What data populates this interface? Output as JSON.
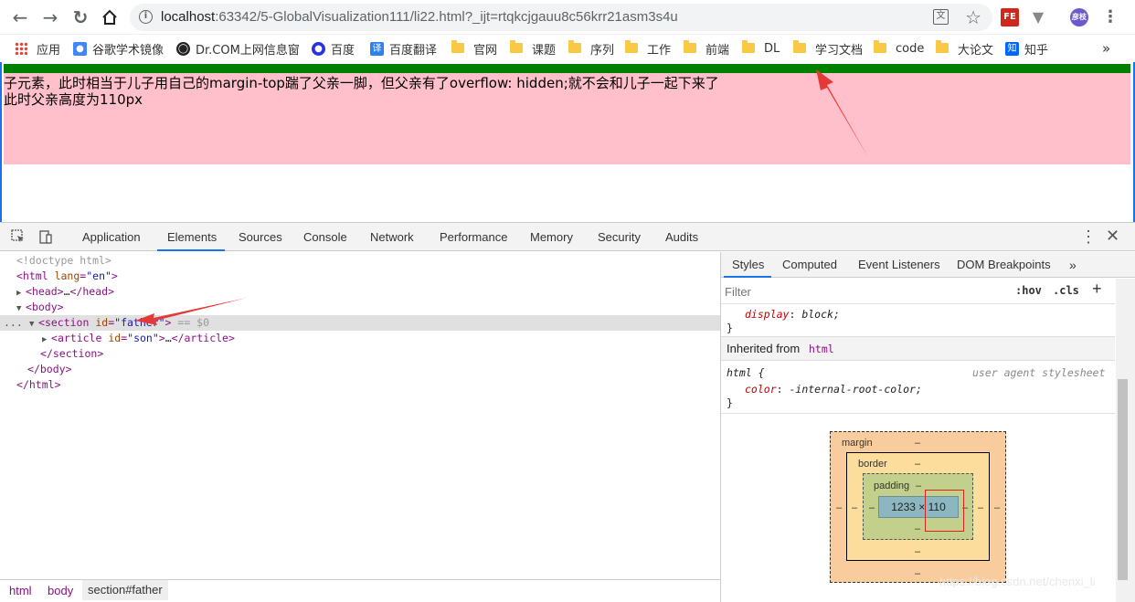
{
  "browser": {
    "url_host": "localhost",
    "url_rest": ":63342/5-GlobalVisualization111/li22.html?_ijt=rtqkcjgauu8c56krr21asm3s4u",
    "profile_initials": "彦枝",
    "ext_fe": "FE",
    "translate_label": "文"
  },
  "bookmarks": [
    {
      "label": "应用",
      "icon": "apps-grid-icon"
    },
    {
      "label": "谷歌学术镜像",
      "icon": "scholar-icon"
    },
    {
      "label": "Dr.COM上网信息窗",
      "icon": "globe-icon"
    },
    {
      "label": "百度",
      "icon": "baidu-paw-icon"
    },
    {
      "label": "百度翻译",
      "icon": "translate-icon"
    },
    {
      "label": "官网",
      "icon": "folder-icon"
    },
    {
      "label": "课题",
      "icon": "folder-icon"
    },
    {
      "label": "序列",
      "icon": "folder-icon"
    },
    {
      "label": "工作",
      "icon": "folder-icon"
    },
    {
      "label": "前端",
      "icon": "folder-icon"
    },
    {
      "label": "DL",
      "icon": "folder-icon"
    },
    {
      "label": "学习文档",
      "icon": "folder-icon"
    },
    {
      "label": "code",
      "icon": "folder-icon"
    },
    {
      "label": "大论文",
      "icon": "folder-icon"
    },
    {
      "label": "知乎",
      "icon": "zhihu-icon"
    }
  ],
  "bookmarks_more": "»",
  "page": {
    "line1": "子元素，此时相当于儿子用自己的margin-top踹了父亲一脚，但父亲有了overflow: hidden;就不会和儿子一起下来了",
    "line2": "此时父亲高度为110px",
    "father_color": "#ffc0cb",
    "top_bar_color": "#008000"
  },
  "devtools": {
    "tabs": [
      "Application",
      "Elements",
      "Sources",
      "Console",
      "Network",
      "Performance",
      "Memory",
      "Security",
      "Audits"
    ],
    "active_tab": "Elements",
    "dom": {
      "doctype": "<!doctype html>",
      "html_open_tag": "html",
      "html_attr": "lang",
      "html_attr_val": "\"en\"",
      "head": "head",
      "head_ellipsis": "…",
      "body": "body",
      "section_tag": "section",
      "section_attr": "id",
      "section_val": "\"father\"",
      "selected_suffix": "== $0",
      "article_tag": "article",
      "article_attr": "id",
      "article_val": "\"son\"",
      "article_ellipsis": "…",
      "section_close": "/section",
      "body_close": "/body",
      "html_close": "/html",
      "row_dots": "..."
    },
    "breadcrumbs": [
      "html",
      "body",
      "section#father"
    ],
    "styles": {
      "tabs": [
        "Styles",
        "Computed",
        "Event Listeners",
        "DOM Breakpoints"
      ],
      "tabs_more": "»",
      "filter_placeholder": "Filter",
      "hov": ":hov",
      "cls": ".cls",
      "plus": "+",
      "rule1_prop": "display",
      "rule1_val": "block;",
      "rule1_close": "}",
      "inherited_label": "Inherited from",
      "inherited_tag": "html",
      "rule2_selector": "html {",
      "rule2_source": "user agent stylesheet",
      "rule2_prop": "color",
      "rule2_val": "-internal-root-color;",
      "rule2_close": "}"
    },
    "box_model": {
      "margin_label": "margin",
      "border_label": "border",
      "padding_label": "padding",
      "dash": "–",
      "content": "1233 × 110",
      "margin_color": "#f9cc9d",
      "border_color": "#fddd9b",
      "padding_color": "#c3d08b",
      "content_color": "#8cb6c0"
    }
  },
  "watermark": "https://blog.csdn.net/chenxi_li"
}
